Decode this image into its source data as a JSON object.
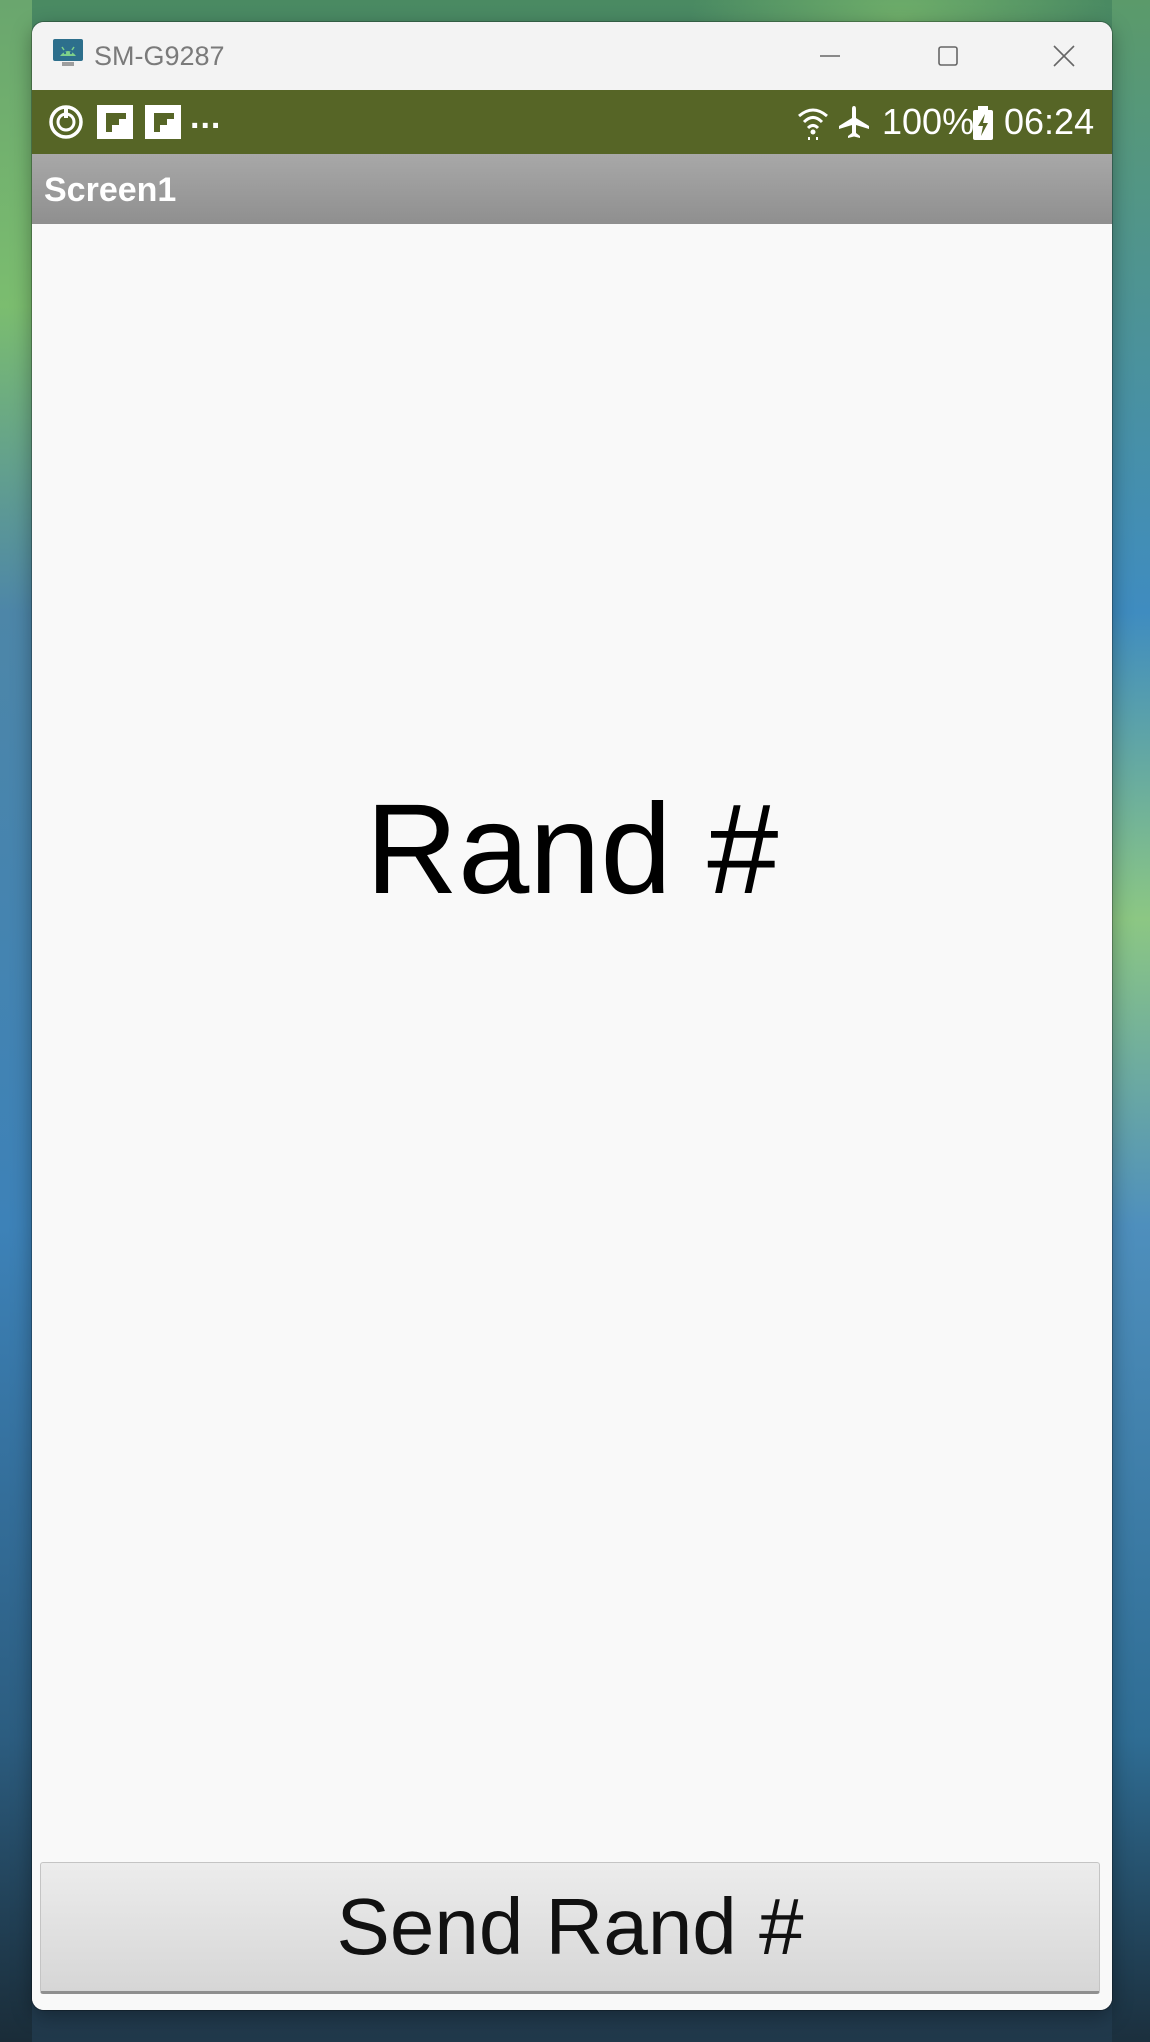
{
  "window": {
    "title": "SM-G9287",
    "icon": "android-emulator-icon",
    "controls": [
      "minimize-icon",
      "maximize-icon",
      "close-icon"
    ]
  },
  "status_bar": {
    "left_icons": [
      "sync-icon",
      "flipboard-icon",
      "flipboard-icon"
    ],
    "overflow": "...",
    "right_icons": [
      "wifi-icon",
      "airplane-mode-icon"
    ],
    "battery_percent": "100%",
    "battery_icon": "battery-charging-icon",
    "time": "06:24",
    "background_color": "#566526"
  },
  "app_bar": {
    "title": "Screen1"
  },
  "main": {
    "label": "Rand #",
    "button_label": "Send Rand #"
  }
}
